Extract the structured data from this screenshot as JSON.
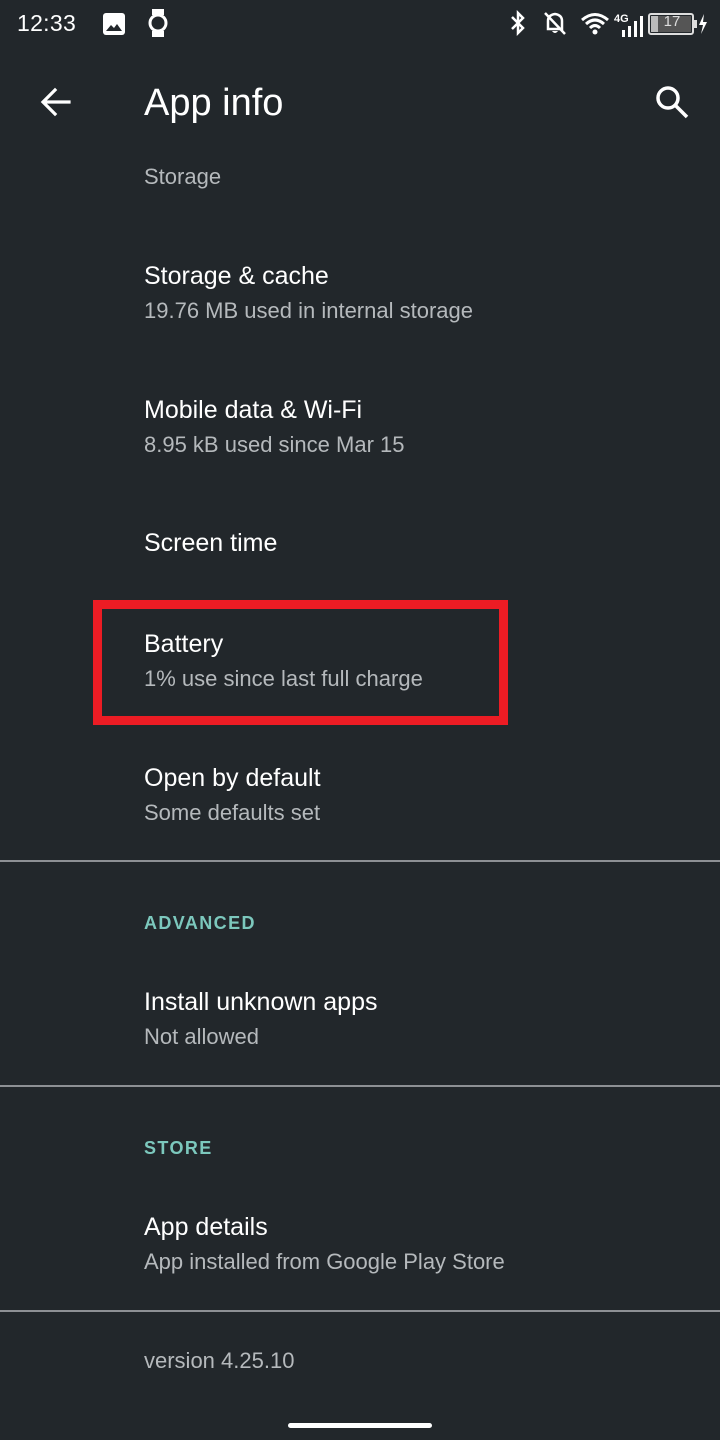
{
  "status_bar": {
    "time": "12:33",
    "icons": [
      "gallery-icon",
      "watch-icon",
      "bluetooth-icon",
      "notifications-off-icon",
      "wifi-icon",
      "signal-4g-icon",
      "battery-icon",
      "charging-icon"
    ],
    "network_label": "4G",
    "battery_level": "17"
  },
  "app_bar": {
    "title": "App info",
    "back_icon": "arrow-back-icon",
    "search_icon": "search-icon"
  },
  "content": {
    "partial_header": "Storage",
    "items": [
      {
        "title": "Storage & cache",
        "summary": "19.76 MB used in internal storage"
      },
      {
        "title": "Mobile data & Wi‑Fi",
        "summary": "8.95 kB used since Mar 15"
      },
      {
        "title": "Screen time",
        "summary": ""
      },
      {
        "title": "Battery",
        "summary": "1% use since last full charge"
      },
      {
        "title": "Open by default",
        "summary": "Some defaults set"
      }
    ],
    "advanced": {
      "label": "ADVANCED",
      "items": [
        {
          "title": "Install unknown apps",
          "summary": "Not allowed"
        }
      ]
    },
    "store": {
      "label": "STORE",
      "items": [
        {
          "title": "App details",
          "summary": "App installed from Google Play Store"
        }
      ]
    },
    "version": "version 4.25.10"
  },
  "colors": {
    "background": "#22272b",
    "accent": "#7cc8bd",
    "highlight": "#ec1c24",
    "secondary_text": "#b5b9bc"
  }
}
